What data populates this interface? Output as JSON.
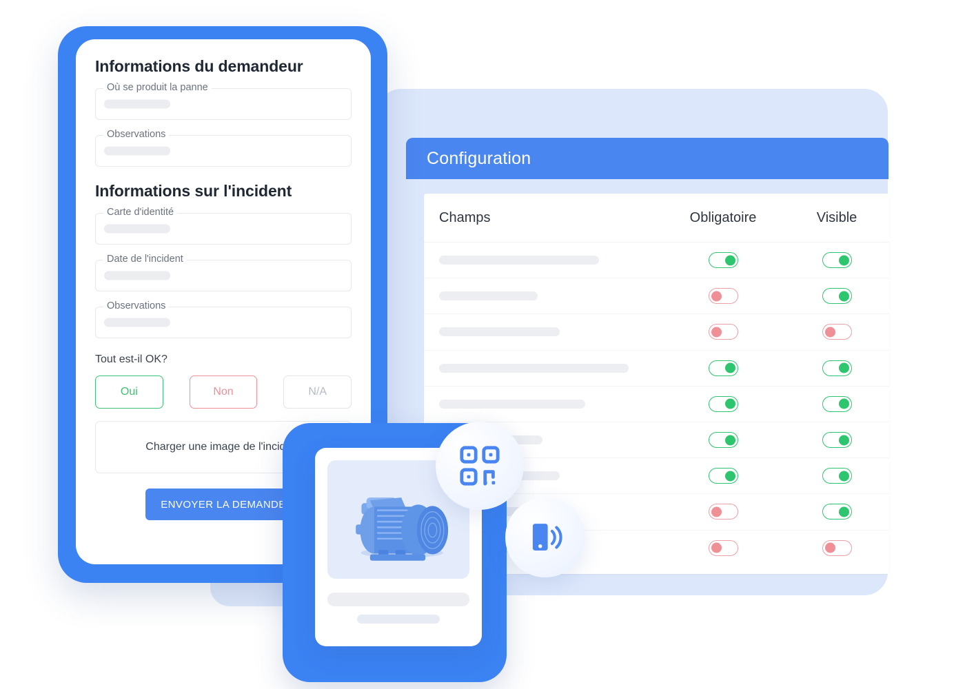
{
  "mobile_form": {
    "section1_title": "Informations du demandeur",
    "section2_title": "Informations sur l'incident",
    "fields_section1": [
      {
        "label": "Où se produit la panne",
        "value": ""
      },
      {
        "label": "Observations",
        "value": ""
      }
    ],
    "fields_section2": [
      {
        "label": "Carte d'identité",
        "value": ""
      },
      {
        "label": "Date de l'incident",
        "value": ""
      },
      {
        "label": "Observations",
        "value": ""
      }
    ],
    "question_label": "Tout est-il OK?",
    "choices": [
      {
        "label": "Oui",
        "state": "yes",
        "color": "#3fbf74"
      },
      {
        "label": "Non",
        "state": "no",
        "color": "#ef8f96"
      },
      {
        "label": "N/A",
        "state": "na",
        "color": "#b6bcc6"
      }
    ],
    "upload_label": "Charger une image de l'incident",
    "submit_label": "ENVOYER LA DEMANDE"
  },
  "configuration_panel": {
    "header_title": "Configuration",
    "header_color": "#4a86f0",
    "backdrop_color": "#dce7fb",
    "columns": [
      "Champs",
      "Obligatoire",
      "Visible"
    ],
    "rows": [
      {
        "field_width": 232,
        "obligatoire": "on",
        "visible": "on"
      },
      {
        "field_width": 143,
        "obligatoire": "off",
        "visible": "on"
      },
      {
        "field_width": 175,
        "obligatoire": "off",
        "visible": "off"
      },
      {
        "field_width": 275,
        "obligatoire": "on",
        "visible": "on"
      },
      {
        "field_width": 212,
        "obligatoire": "on",
        "visible": "on"
      },
      {
        "field_width": 150,
        "obligatoire": "on",
        "visible": "on"
      },
      {
        "field_width": 175,
        "obligatoire": "on",
        "visible": "on"
      },
      {
        "field_width": 160,
        "obligatoire": "off",
        "visible": "on"
      },
      {
        "field_width": 128,
        "obligatoire": "off",
        "visible": "off"
      }
    ],
    "toggle_on_color": "#2dc56d",
    "toggle_off_color": "#ef8f96"
  },
  "asset_card": {
    "image_alt": "blue-electric-motor",
    "image_color": "#4a86f0"
  },
  "floating_icons": [
    {
      "name": "qr-code-icon",
      "color": "#4a86f0"
    },
    {
      "name": "nfc-mobile-icon",
      "color": "#4a86f0"
    }
  ]
}
